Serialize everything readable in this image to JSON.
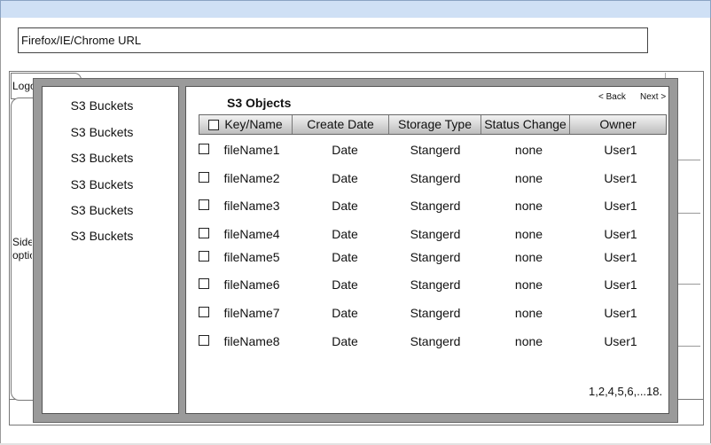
{
  "browser": {
    "url_placeholder": "Firefox/IE/Chrome URL"
  },
  "background_page": {
    "logo_label": "Logo",
    "sidebar_label_line1": "Side",
    "sidebar_label_line2": "optio"
  },
  "buckets": {
    "items": [
      "S3 Buckets",
      "S3 Buckets",
      "S3 Buckets",
      "S3 Buckets",
      "S3 Buckets",
      "S3 Buckets"
    ]
  },
  "objects": {
    "title": "S3 Objects",
    "back_label": "< Back",
    "next_label": "Next >",
    "columns": [
      "Key/Name",
      "Create Date",
      "Storage Type",
      "Status Change",
      "Owner"
    ],
    "rows": [
      {
        "name": "fileName1",
        "date": "Date",
        "storage": "Stangerd",
        "status": "none",
        "owner": "User1"
      },
      {
        "name": "fileName2",
        "date": "Date",
        "storage": "Stangerd",
        "status": "none",
        "owner": "User1"
      },
      {
        "name": "fileName3",
        "date": "Date",
        "storage": "Stangerd",
        "status": "none",
        "owner": "User1"
      },
      {
        "name": "fileName4",
        "date": "Date",
        "storage": "Stangerd",
        "status": "none",
        "owner": "User1"
      },
      {
        "name": "fileName5",
        "date": "Date",
        "storage": "Stangerd",
        "status": "none",
        "owner": "User1"
      },
      {
        "name": "fileName6",
        "date": "Date",
        "storage": "Stangerd",
        "status": "none",
        "owner": "User1"
      },
      {
        "name": "fileName7",
        "date": "Date",
        "storage": "Stangerd",
        "status": "none",
        "owner": "User1"
      },
      {
        "name": "fileName8",
        "date": "Date",
        "storage": "Stangerd",
        "status": "none",
        "owner": "User1"
      }
    ],
    "pagination": "1,2,4,5,6,...18."
  }
}
